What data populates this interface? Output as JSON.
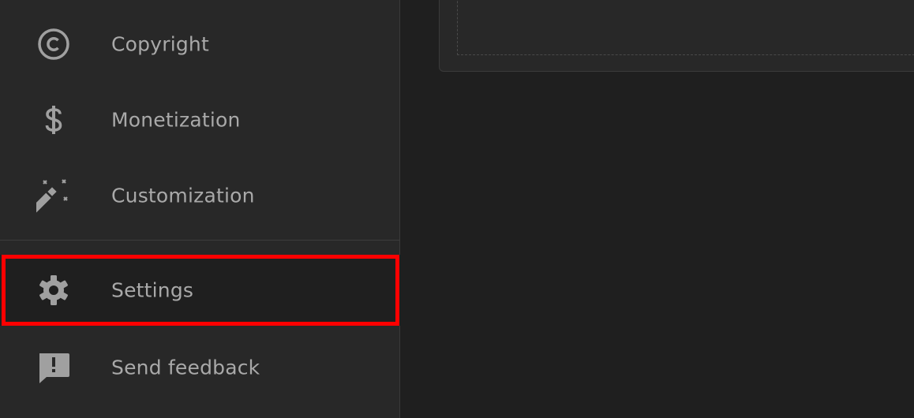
{
  "sidebar": {
    "items": [
      {
        "label": "Copyright",
        "icon": "copyright-icon"
      },
      {
        "label": "Monetization",
        "icon": "dollar-icon"
      },
      {
        "label": "Customization",
        "icon": "magic-wand-icon"
      },
      {
        "label": "Settings",
        "icon": "gear-icon",
        "selected": true
      },
      {
        "label": "Send feedback",
        "icon": "feedback-icon"
      }
    ]
  },
  "colors": {
    "sidebar_bg": "#282828",
    "content_bg": "#1f1f1f",
    "text": "#a9a9a9",
    "icon": "#a0a0a0",
    "highlight": "#ff0000"
  }
}
